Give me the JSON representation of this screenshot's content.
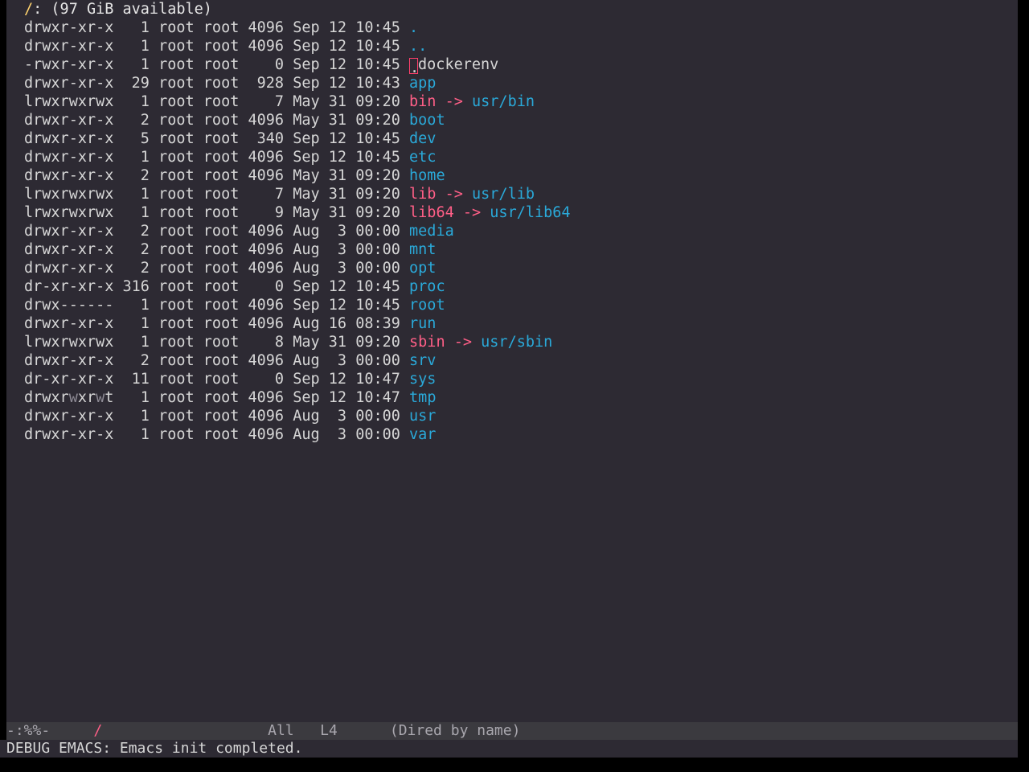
{
  "header": {
    "dir": "/",
    "rest": ": (97 GiB available)"
  },
  "entries": [
    {
      "perms": "drwxr-xr-x",
      "links": "1",
      "owner": "root",
      "group": "root",
      "size": "4096",
      "month": "Sep",
      "day": "12",
      "time": "10:45",
      "name": ".",
      "type": "dir"
    },
    {
      "perms": "drwxr-xr-x",
      "links": "1",
      "owner": "root",
      "group": "root",
      "size": "4096",
      "month": "Sep",
      "day": "12",
      "time": "10:45",
      "name": "..",
      "type": "dir"
    },
    {
      "perms": "-rwxr-xr-x",
      "links": "1",
      "owner": "root",
      "group": "root",
      "size": "0",
      "month": "Sep",
      "day": "12",
      "time": "10:45",
      "name": "dockerenv",
      "type": "file",
      "cursor_char": "."
    },
    {
      "perms": "drwxr-xr-x",
      "links": "29",
      "owner": "root",
      "group": "root",
      "size": "928",
      "month": "Sep",
      "day": "12",
      "time": "10:43",
      "name": "app",
      "type": "dir"
    },
    {
      "perms": "lrwxrwxrwx",
      "links": "1",
      "owner": "root",
      "group": "root",
      "size": "7",
      "month": "May",
      "day": "31",
      "time": "09:20",
      "name": "bin",
      "type": "link",
      "target": "usr/bin"
    },
    {
      "perms": "drwxr-xr-x",
      "links": "2",
      "owner": "root",
      "group": "root",
      "size": "4096",
      "month": "May",
      "day": "31",
      "time": "09:20",
      "name": "boot",
      "type": "dir"
    },
    {
      "perms": "drwxr-xr-x",
      "links": "5",
      "owner": "root",
      "group": "root",
      "size": "340",
      "month": "Sep",
      "day": "12",
      "time": "10:45",
      "name": "dev",
      "type": "dir"
    },
    {
      "perms": "drwxr-xr-x",
      "links": "1",
      "owner": "root",
      "group": "root",
      "size": "4096",
      "month": "Sep",
      "day": "12",
      "time": "10:45",
      "name": "etc",
      "type": "dir"
    },
    {
      "perms": "drwxr-xr-x",
      "links": "2",
      "owner": "root",
      "group": "root",
      "size": "4096",
      "month": "May",
      "day": "31",
      "time": "09:20",
      "name": "home",
      "type": "dir"
    },
    {
      "perms": "lrwxrwxrwx",
      "links": "1",
      "owner": "root",
      "group": "root",
      "size": "7",
      "month": "May",
      "day": "31",
      "time": "09:20",
      "name": "lib",
      "type": "link",
      "target": "usr/lib"
    },
    {
      "perms": "lrwxrwxrwx",
      "links": "1",
      "owner": "root",
      "group": "root",
      "size": "9",
      "month": "May",
      "day": "31",
      "time": "09:20",
      "name": "lib64",
      "type": "link",
      "target": "usr/lib64"
    },
    {
      "perms": "drwxr-xr-x",
      "links": "2",
      "owner": "root",
      "group": "root",
      "size": "4096",
      "month": "Aug",
      "day": "3",
      "time": "00:00",
      "name": "media",
      "type": "dir"
    },
    {
      "perms": "drwxr-xr-x",
      "links": "2",
      "owner": "root",
      "group": "root",
      "size": "4096",
      "month": "Aug",
      "day": "3",
      "time": "00:00",
      "name": "mnt",
      "type": "dir"
    },
    {
      "perms": "drwxr-xr-x",
      "links": "2",
      "owner": "root",
      "group": "root",
      "size": "4096",
      "month": "Aug",
      "day": "3",
      "time": "00:00",
      "name": "opt",
      "type": "dir"
    },
    {
      "perms": "dr-xr-xr-x",
      "links": "316",
      "owner": "root",
      "group": "root",
      "size": "0",
      "month": "Sep",
      "day": "12",
      "time": "10:45",
      "name": "proc",
      "type": "dir"
    },
    {
      "perms": "drwx------",
      "links": "1",
      "owner": "root",
      "group": "root",
      "size": "4096",
      "month": "Sep",
      "day": "12",
      "time": "10:45",
      "name": "root",
      "type": "dir"
    },
    {
      "perms": "drwxr-xr-x",
      "links": "1",
      "owner": "root",
      "group": "root",
      "size": "4096",
      "month": "Aug",
      "day": "16",
      "time": "08:39",
      "name": "run",
      "type": "dir"
    },
    {
      "perms": "lrwxrwxrwx",
      "links": "1",
      "owner": "root",
      "group": "root",
      "size": "8",
      "month": "May",
      "day": "31",
      "time": "09:20",
      "name": "sbin",
      "type": "link",
      "target": "usr/sbin"
    },
    {
      "perms": "drwxr-xr-x",
      "links": "2",
      "owner": "root",
      "group": "root",
      "size": "4096",
      "month": "Aug",
      "day": "3",
      "time": "00:00",
      "name": "srv",
      "type": "dir"
    },
    {
      "perms": "dr-xr-xr-x",
      "links": "11",
      "owner": "root",
      "group": "root",
      "size": "0",
      "month": "Sep",
      "day": "12",
      "time": "10:47",
      "name": "sys",
      "type": "dir"
    },
    {
      "perms": "drwxrwxrwt",
      "links": "1",
      "owner": "root",
      "group": "root",
      "size": "4096",
      "month": "Sep",
      "day": "12",
      "time": "10:47",
      "name": "tmp",
      "type": "dir",
      "sticky": true
    },
    {
      "perms": "drwxr-xr-x",
      "links": "1",
      "owner": "root",
      "group": "root",
      "size": "4096",
      "month": "Aug",
      "day": "3",
      "time": "00:00",
      "name": "usr",
      "type": "dir"
    },
    {
      "perms": "drwxr-xr-x",
      "links": "1",
      "owner": "root",
      "group": "root",
      "size": "4096",
      "month": "Aug",
      "day": "3",
      "time": "00:00",
      "name": "var",
      "type": "dir"
    }
  ],
  "modeline": {
    "status": "-:%%-",
    "buffer": "/",
    "position": "All",
    "line": "L4",
    "mode": "(Dired by name)"
  },
  "minibuffer": {
    "message": "DEBUG EMACS: Emacs init completed."
  },
  "colors": {
    "background": "#2d2a33",
    "directory": "#2aa9d9",
    "symlink": "#ff5f87",
    "header_dir": "#ffd36e"
  }
}
